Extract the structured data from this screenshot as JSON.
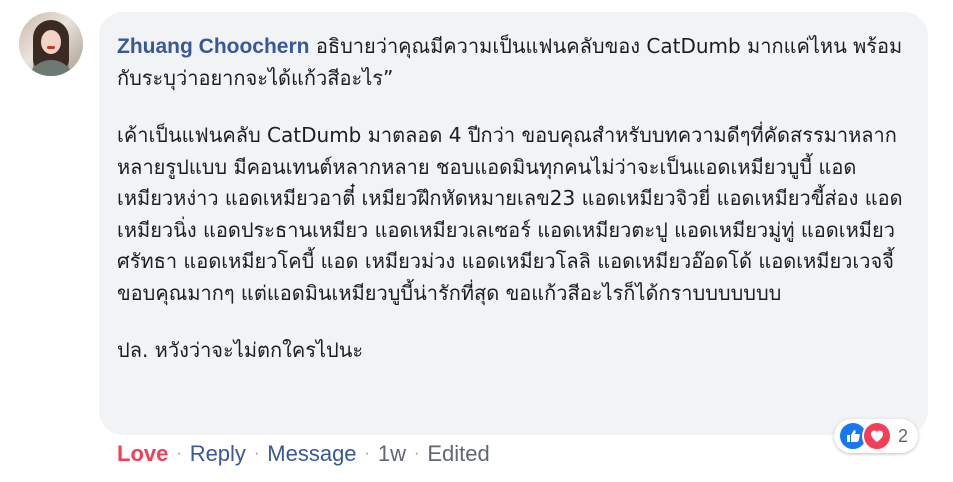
{
  "comment": {
    "author": "Zhuang Choochern",
    "question": " อธิบายว่าคุณมีความเป็นแฟนคลับของ CatDumb มากแค่ไหน พร้อมกับระบุว่าอยากจะได้แก้วสีอะไร”",
    "body": "เค้าเป็นแฟนคลับ CatDumb มาตลอด 4 ปีกว่า ขอบคุณสำหรับบทความดีๆที่คัดสรรมาหลากหลายรูปแบบ มีคอนเทนต์หลากหลาย ชอบแอดมินทุกคนไม่ว่าจะเป็นแอดเหมียวบูบี้ แอดเหมียวหง่าว แอดเหมียวอาตี๋ เหมียวฝึกหัดหมายเลข23 แอดเหมียวจิวยี่ แอดเหมียวขี้ส่อง แอดเหมียวนิ่ง แอดประธานเหมียว แอดเหมียวเลเซอร์ แอดเหมียวตะปู แอดเหมียวมู่ทู่ แอดเหมียวศรัทธา แอดเหมียวโคบี้ แอด เหมียวม่วง แอดเหมียวโลลิ แอดเหมียวอ๊อดโด้ แอดเหมียวเวจจี้ ขอบคุณมากๆ แต่แอดมินเหมียวบูบี้น่ารักที่สุด ขอแก้วสีอะไรก็ได้กราบบบบบบบ",
    "ps": "ปล. หวังว่าจะไม่ตกใครไปนะ"
  },
  "reactions": {
    "icons": [
      "like-icon",
      "love-icon"
    ],
    "count": "2"
  },
  "actions": {
    "love": "Love",
    "reply": "Reply",
    "message": "Message",
    "time": "1w",
    "edited": "Edited",
    "separator": "·"
  },
  "colors": {
    "author": "#385898",
    "love": "#f33e58",
    "bubble": "#f2f3f5",
    "like": "#1877f2"
  }
}
